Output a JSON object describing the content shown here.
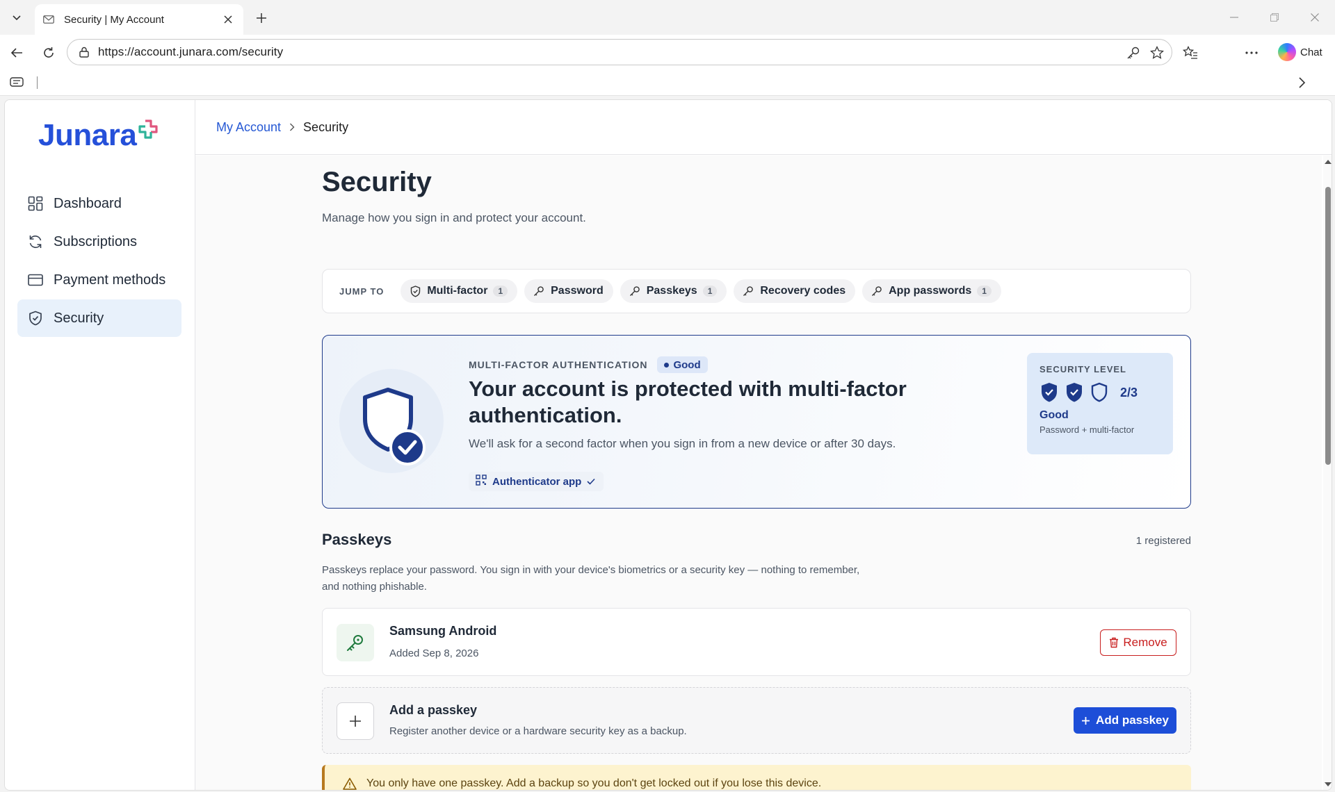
{
  "browser": {
    "tab_title": "Security | My Account",
    "url": "https://account.junara.com/security",
    "chat_label": "Chat"
  },
  "brand": {
    "name": "Junara",
    "color": "#2550d9"
  },
  "sidebar": {
    "items": [
      {
        "label": "Dashboard",
        "icon": "dashboard-icon"
      },
      {
        "label": "Subscriptions",
        "icon": "refresh-icon"
      },
      {
        "label": "Payment methods",
        "icon": "card-icon"
      },
      {
        "label": "Security",
        "icon": "shield-icon",
        "active": true
      }
    ]
  },
  "breadcrumb": {
    "parent": "My Account",
    "current": "Security"
  },
  "page": {
    "title": "Security",
    "subtitle": "Manage how you sign in and protect your account."
  },
  "jump": {
    "label": "JUMP TO",
    "chips": [
      {
        "label": "Multi-factor",
        "count": "1",
        "icon": "shield-icon"
      },
      {
        "label": "Password",
        "count": "",
        "icon": "key-icon"
      },
      {
        "label": "Passkeys",
        "count": "1",
        "icon": "key-icon"
      },
      {
        "label": "Recovery codes",
        "count": "",
        "icon": "key-icon"
      },
      {
        "label": "App passwords",
        "count": "1",
        "icon": "key-icon"
      }
    ]
  },
  "mfa": {
    "kicker": "MULTI-FACTOR AUTHENTICATION",
    "status": "Good",
    "title": "Your account is protected with multi-factor authentication.",
    "description": "We'll ask for a second factor when you sign in from a new device or after 30 days.",
    "method": "Authenticator app",
    "level": {
      "label": "SECURITY LEVEL",
      "score": "2/3",
      "filled": 2,
      "total": 3,
      "rating": "Good",
      "detail": "Password + multi-factor"
    }
  },
  "passkeys": {
    "title": "Passkeys",
    "count_label": "1 registered",
    "description": "Passkeys replace your password. You sign in with your device's biometrics or a security key — nothing to remember, and nothing phishable.",
    "items": [
      {
        "name": "Samsung Android",
        "added": "Added Sep 8, 2026",
        "remove_label": "Remove"
      }
    ],
    "add": {
      "title": "Add a passkey",
      "description": "Register another device or a hardware security key as a backup.",
      "button": "Add passkey"
    },
    "warning": "You only have one passkey. Add a backup so you don't get locked out if you lose this device."
  },
  "colors": {
    "accent": "#1d4ed8",
    "navy": "#1e3a8a",
    "danger": "#c81e1e",
    "warning_bg": "#fdf3cf"
  }
}
